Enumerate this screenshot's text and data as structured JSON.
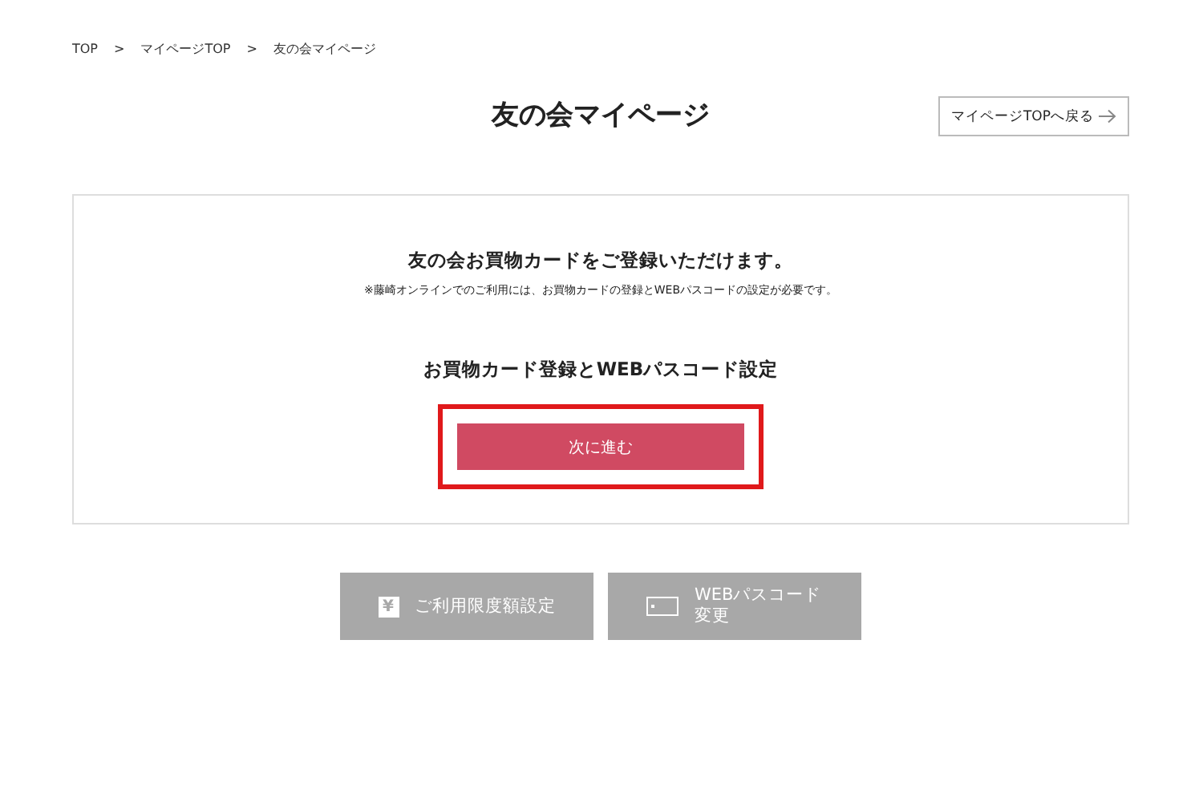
{
  "breadcrumb": [
    {
      "label": "TOP"
    },
    {
      "label": "マイページTOP"
    },
    {
      "label": "友の会マイページ"
    }
  ],
  "breadcrumb_separator": ">",
  "page_title": "友の会マイページ",
  "back_button": {
    "label": "マイページTOPへ戻る"
  },
  "card": {
    "heading": "友の会お買物カードをご登録いただけます。",
    "note": "※藤崎オンラインでのご利用には、お買物カードの登録とWEBパスコードの設定が必要です。",
    "subheading": "お買物カード登録とWEBパスコード設定",
    "next_button": {
      "label": "次に進む",
      "highlighted": true
    }
  },
  "actions": [
    {
      "kind": "yen",
      "icon_text": "¥",
      "label": "ご利用限度額設定",
      "disabled": true
    },
    {
      "kind": "card",
      "label": "WEBパスコード変更",
      "disabled": true
    }
  ]
}
